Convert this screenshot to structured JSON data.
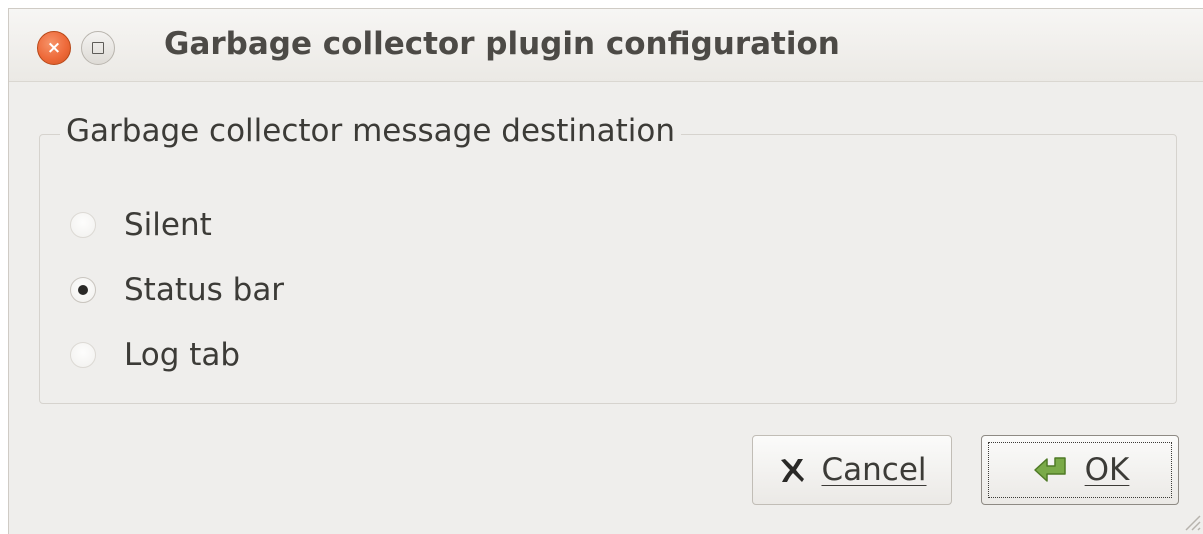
{
  "window": {
    "title": "Garbage collector plugin configuration",
    "close_glyph": "×",
    "close_icon": "close-icon",
    "maximize_icon": "maximize-icon"
  },
  "group": {
    "legend": "Garbage collector message destination",
    "options": [
      {
        "label": "Silent",
        "checked": false
      },
      {
        "label": "Status bar",
        "checked": true
      },
      {
        "label": "Log tab",
        "checked": false
      }
    ]
  },
  "buttons": {
    "cancel_label": "Cancel",
    "cancel_icon": "cross-icon",
    "ok_label": "OK",
    "ok_icon": "return-arrow-icon"
  },
  "colors": {
    "close_button": "#ee6a3a",
    "window_bg": "#efeeec",
    "cancel_icon": "#2a2927",
    "ok_icon": "#6a9a3a"
  }
}
